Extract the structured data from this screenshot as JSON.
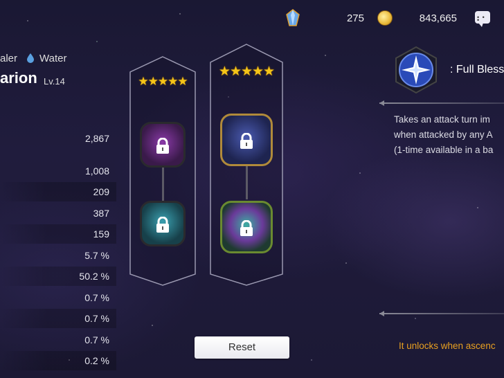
{
  "currency": {
    "crystal_count": "275",
    "gold_count": "843,665"
  },
  "hero": {
    "class_text": "aler",
    "element": "Water",
    "name": "arion",
    "level": "Lv.14"
  },
  "stats": [
    "2,867",
    "1,008",
    "209",
    "387",
    "159",
    "5.7 %",
    "50.2 %",
    "0.7 %",
    "0.7 %",
    "0.7 %",
    "0.2 %"
  ],
  "tree": {
    "left_stars": "★★★★★",
    "right_stars": "★★★★★",
    "left_nodes": [
      {
        "locked": true,
        "theme": "purple-weapon"
      },
      {
        "locked": true,
        "theme": "teal-figure"
      }
    ],
    "right_nodes": [
      {
        "locked": true,
        "theme": "blue-star-gold-frame"
      },
      {
        "locked": true,
        "theme": "rainbow-green-frame"
      }
    ]
  },
  "skill": {
    "icon": "full-blessing-star-icon",
    "title": ": Full Bless",
    "description": [
      "Takes an attack turn im",
      "when attacked by any A",
      "(1-time available in a ba"
    ],
    "unlock_note": "It unlocks when ascenc"
  },
  "reset_label": "Reset",
  "colors": {
    "star": "#f5c518",
    "unlock_note": "#e8a020",
    "background": "#1d1a38"
  }
}
